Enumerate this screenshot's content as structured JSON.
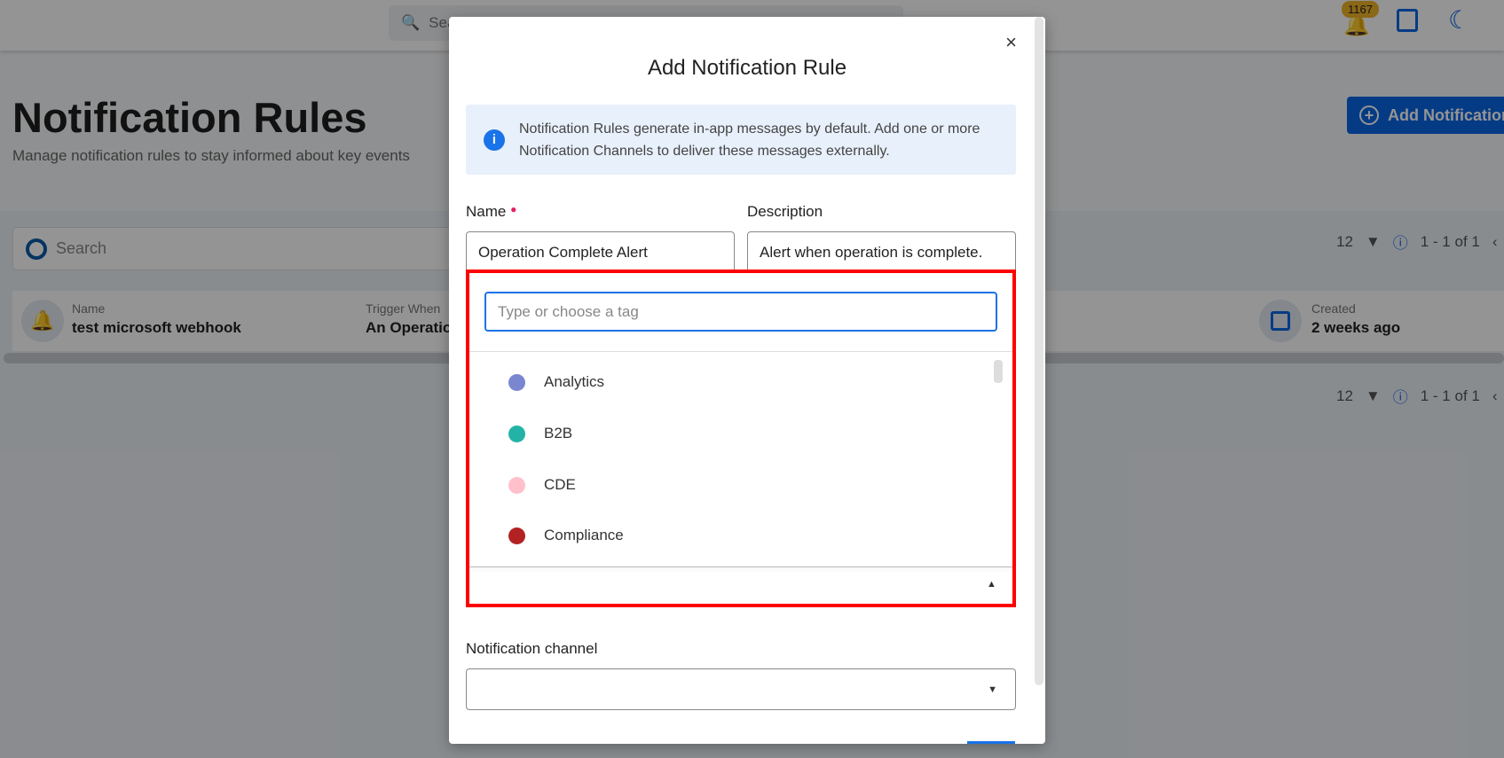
{
  "topbar": {
    "search_placeholder": "Search",
    "notification_count": "1167"
  },
  "page": {
    "title": "Notification Rules",
    "subtitle": "Manage notification rules to stay informed about key events",
    "add_button": "Add Notification"
  },
  "list": {
    "search_placeholder": "Search",
    "page_size": "12",
    "range": "1 - 1 of 1",
    "rule": {
      "name_label": "Name",
      "name": "test microsoft webhook",
      "trigger_label": "Trigger When",
      "trigger": "An Operatio",
      "created_label": "Created",
      "created": "2 weeks ago"
    }
  },
  "modal": {
    "title": "Add Notification Rule",
    "close": "×",
    "info": "Notification Rules generate in-app messages by default. Add one or more Notification Channels to deliver these messages externally.",
    "name_label": "Name",
    "name_value": "Operation Complete Alert",
    "description_label": "Description",
    "description_value": "Alert when operation is complete.",
    "tag_placeholder": "Type or choose a tag",
    "tags": [
      {
        "label": "Analytics",
        "color": "#7b86d0"
      },
      {
        "label": "B2B",
        "color": "#22b3a6"
      },
      {
        "label": "CDE",
        "color": "#ffc0cb"
      },
      {
        "label": "Compliance",
        "color": "#b22222"
      }
    ],
    "channel_label": "Notification channel"
  },
  "colors": {
    "accent": "#1a73e8",
    "highlight": "#ff0000",
    "required": "#e91e63"
  }
}
